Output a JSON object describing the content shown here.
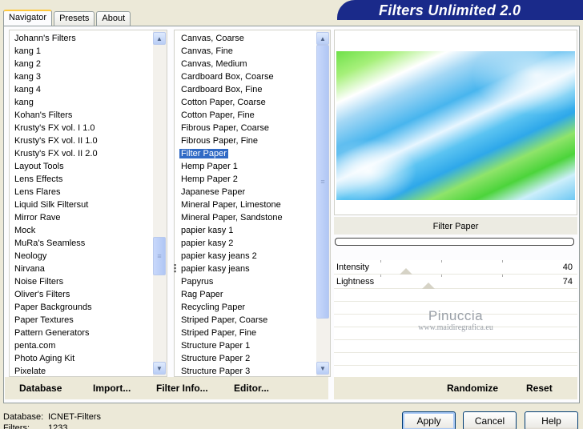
{
  "tabs": [
    {
      "label": "Navigator",
      "active": true
    },
    {
      "label": "Presets",
      "active": false
    },
    {
      "label": "About",
      "active": false
    }
  ],
  "banner_title": "Filters Unlimited 2.0",
  "categories": [
    "Johann's Filters",
    "kang 1",
    "kang 2",
    "kang 3",
    "kang 4",
    "kang",
    "Kohan's Filters",
    "Krusty's FX vol. I 1.0",
    "Krusty's FX vol. II 1.0",
    "Krusty's FX vol. II 2.0",
    "Layout Tools",
    "Lens Effects",
    "Lens Flares",
    "Liquid Silk Filtersut",
    "Mirror Rave",
    "Mock",
    "MuRa's Seamless",
    "Neology",
    "Nirvana",
    "Noise Filters",
    "Oliver's Filters",
    "Paper Backgrounds",
    "Paper Textures",
    "Pattern Generators",
    "penta.com",
    "Photo Aging Kit",
    "Pixelate"
  ],
  "filters": [
    "Canvas, Coarse",
    "Canvas, Fine",
    "Canvas, Medium",
    "Cardboard Box, Coarse",
    "Cardboard Box, Fine",
    "Cotton Paper, Coarse",
    "Cotton Paper, Fine",
    "Fibrous Paper, Coarse",
    "Fibrous Paper, Fine",
    "Filter Paper",
    "Hemp Paper 1",
    "Hemp Paper 2",
    "Japanese Paper",
    "Mineral Paper, Limestone",
    "Mineral Paper, Sandstone",
    "papier kasy 1",
    "papier kasy 2",
    "papier kasy jeans 2",
    "papier kasy jeans",
    "Papyrus",
    "Rag Paper",
    "Recycling Paper",
    "Striped Paper, Coarse",
    "Striped Paper, Fine",
    "Structure Paper 1",
    "Structure Paper 2",
    "Structure Paper 3"
  ],
  "selected_filter_index": 9,
  "preview": {
    "filter_name": "Filter Paper",
    "watermark_line1": "Pinuccia",
    "watermark_line2": "www.maidiregrafica.eu"
  },
  "parameters": [
    {
      "label": "Intensity",
      "value": "40",
      "level": 0.157
    },
    {
      "label": "Lightness",
      "value": "74",
      "level": 0.29
    }
  ],
  "links_left": [
    "Database",
    "Import...",
    "Filter Info...",
    "Editor..."
  ],
  "links_right": [
    "Randomize",
    "Reset"
  ],
  "footer": {
    "database_label": "Database:",
    "database_value": "ICNET-Filters",
    "filters_label": "Filters:",
    "filters_value": "1233"
  },
  "buttons": {
    "apply": "Apply",
    "cancel": "Cancel",
    "help": "Help"
  },
  "colors": {
    "banner": "#1a2a8a",
    "selection": "#316ac5"
  }
}
